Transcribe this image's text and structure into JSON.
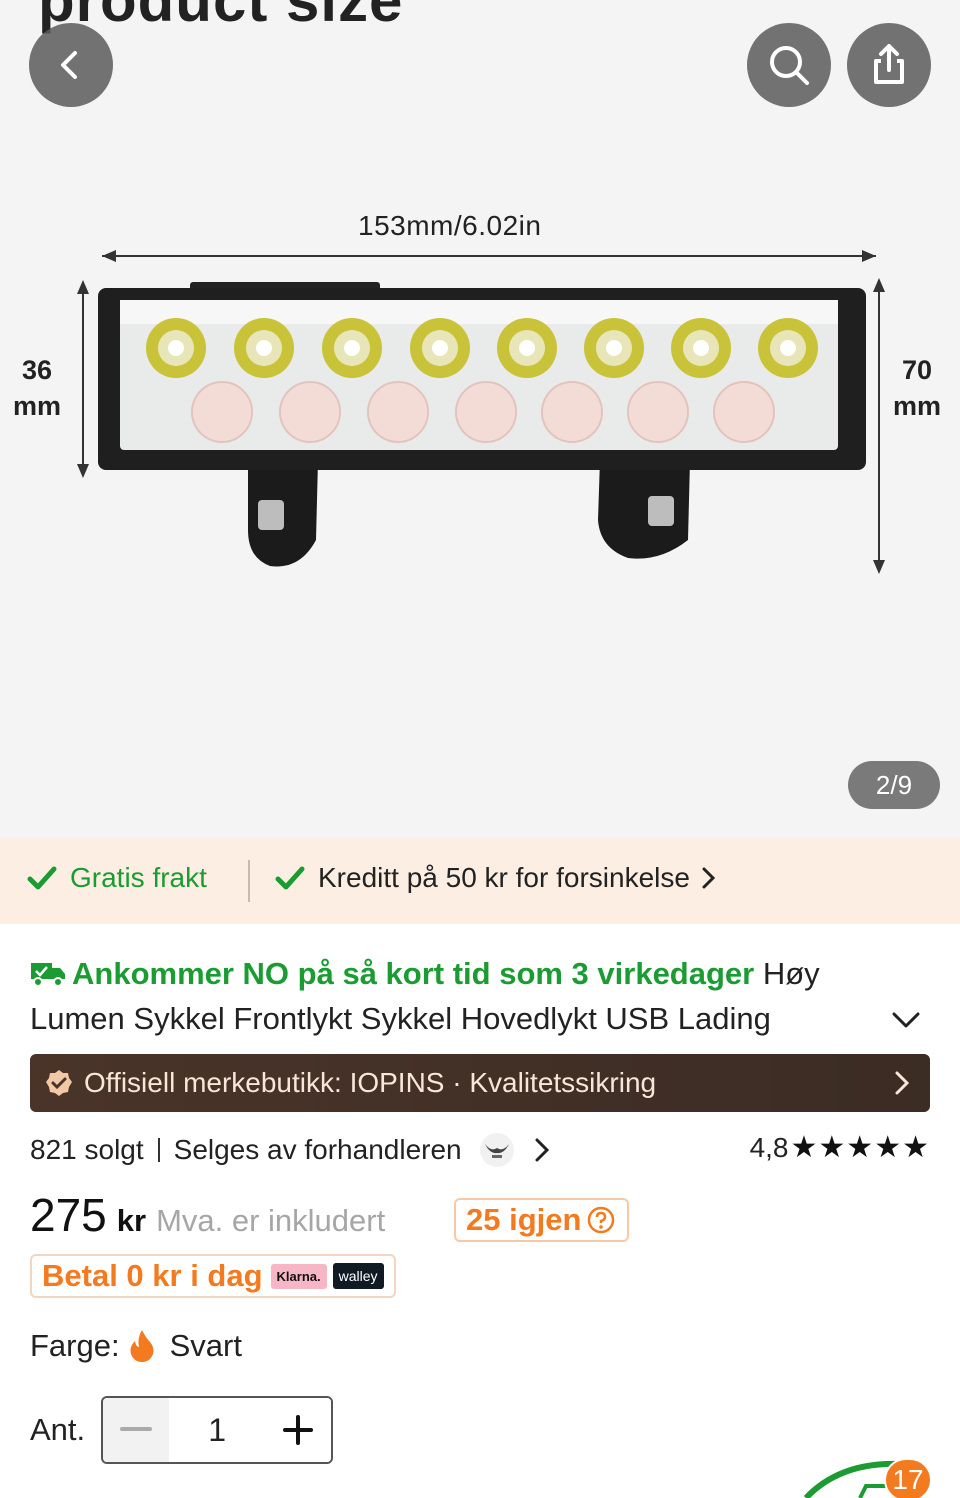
{
  "gallery": {
    "heading": "product size",
    "width_label": "153mm/6.02in",
    "left_label_line1": "36",
    "left_label_line2": "mm",
    "right_label_line1": "70",
    "right_label_line2": "mm",
    "page_indicator": "2/9"
  },
  "benefits": {
    "free_shipping": "Gratis frakt",
    "delay_credit": "Kreditt på 50 kr for forsinkelse"
  },
  "product": {
    "arrival": "Ankommer NO på så kort tid som 3 virkedager",
    "title_line1": "Høy",
    "title_line2": "Lumen Sykkel Frontlykt Sykkel Hovedlykt USB Lading"
  },
  "store": {
    "label": "Offisiell merkebutikk: IOPINS · Kvalitetssikring"
  },
  "meta": {
    "sold": "821 solgt",
    "seller": "Selges av forhandleren",
    "rating": "4,8",
    "stars": "★★★★★"
  },
  "price": {
    "amount": "275",
    "currency": "kr",
    "vat_note": "Mva. er inkludert",
    "stock_left": "25 igjen"
  },
  "payment": {
    "pay_today": "Betal 0 kr i dag",
    "klarna": "Klarna.",
    "walley": "walley"
  },
  "options": {
    "color_label": "Farge:",
    "color_value": "Svart",
    "qty_label": "Ant.",
    "qty_value": "1"
  },
  "cart": {
    "count": "17"
  },
  "colors": {
    "green": "#1a9c32",
    "orange": "#f47a1f",
    "store_bar": "#4a3429",
    "benefit_bg": "#fdeee3"
  }
}
